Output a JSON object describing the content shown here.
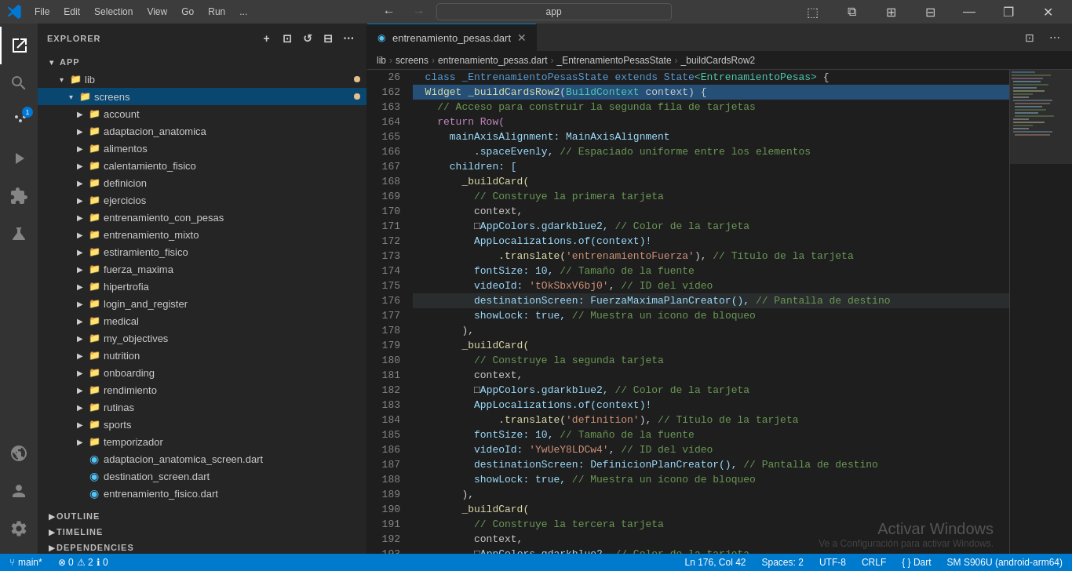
{
  "titlebar": {
    "logo": "⬡",
    "menu_items": [
      "File",
      "Edit",
      "Selection",
      "View",
      "Go",
      "Run",
      "..."
    ],
    "nav_back": "←",
    "nav_forward": "→",
    "search_placeholder": "app",
    "search_value": "app",
    "btn_panel": "▣",
    "btn_split": "⧉",
    "btn_layout": "⊞",
    "btn_customize": "⊟",
    "btn_minimize": "—",
    "btn_maximize": "❐",
    "btn_close": "✕"
  },
  "activity_bar": {
    "icons": [
      {
        "name": "explorer",
        "symbol": "⎘",
        "active": true
      },
      {
        "name": "search",
        "symbol": "🔍",
        "active": false
      },
      {
        "name": "source-control",
        "symbol": "⑂",
        "active": false,
        "badge": "1"
      },
      {
        "name": "run",
        "symbol": "▶",
        "active": false
      },
      {
        "name": "extensions",
        "symbol": "⊞",
        "active": false
      },
      {
        "name": "test",
        "symbol": "⚗",
        "active": false
      },
      {
        "name": "remote",
        "symbol": "◉",
        "active": false
      }
    ],
    "bottom_icons": [
      {
        "name": "account",
        "symbol": "👤"
      },
      {
        "name": "settings",
        "symbol": "⚙"
      }
    ]
  },
  "sidebar": {
    "title": "EXPLORER",
    "actions": [
      "new-file",
      "new-folder",
      "refresh",
      "collapse"
    ],
    "app_section": "APP",
    "tree": {
      "lib": {
        "label": "lib",
        "dot": true,
        "expanded": true,
        "children": {
          "screens": {
            "label": "screens",
            "dot": true,
            "expanded": true,
            "selected": true,
            "children": [
              {
                "label": "account",
                "type": "folder"
              },
              {
                "label": "adaptacion_anatomica",
                "type": "folder"
              },
              {
                "label": "alimentos",
                "type": "folder"
              },
              {
                "label": "calentamiento_fisico",
                "type": "folder"
              },
              {
                "label": "definicion",
                "type": "folder"
              },
              {
                "label": "ejercicios",
                "type": "folder"
              },
              {
                "label": "entrenamiento_con_pesas",
                "type": "folder"
              },
              {
                "label": "entrenamiento_mixto",
                "type": "folder"
              },
              {
                "label": "estiramiento_fisico",
                "type": "folder"
              },
              {
                "label": "fuerza_maxima",
                "type": "folder"
              },
              {
                "label": "hipertrofia",
                "type": "folder"
              },
              {
                "label": "login_and_register",
                "type": "folder"
              },
              {
                "label": "medical",
                "type": "folder"
              },
              {
                "label": "my_objectives",
                "type": "folder"
              },
              {
                "label": "nutrition",
                "type": "folder"
              },
              {
                "label": "onboarding",
                "type": "folder"
              },
              {
                "label": "rendimiento",
                "type": "folder"
              },
              {
                "label": "rutinas",
                "type": "folder"
              },
              {
                "label": "sports",
                "type": "folder"
              },
              {
                "label": "temporizador",
                "type": "folder"
              },
              {
                "label": "adaptacion_anatomica_screen.dart",
                "type": "dart"
              },
              {
                "label": "destination_screen.dart",
                "type": "dart"
              },
              {
                "label": "entrenamiento_fisico.dart",
                "type": "dart"
              }
            ]
          }
        }
      }
    },
    "outline_label": "OUTLINE",
    "timeline_label": "TIMELINE",
    "dependencies_label": "DEPENDENCIES"
  },
  "tabs": [
    {
      "label": "entrenamiento_pesas.dart",
      "active": true,
      "modified": false
    }
  ],
  "breadcrumb": {
    "parts": [
      "lib",
      ">",
      "screens",
      ">",
      "entrenamiento_pesas.dart",
      ">",
      "_EntrenamientoPesasState",
      ">",
      "_buildCardsRow2"
    ]
  },
  "editor": {
    "lines": [
      {
        "num": 26,
        "content": [
          {
            "t": "  class _EntrenamientoPesasState extends State",
            "c": "kw"
          },
          {
            "t": "<EntrenamientoPesas>",
            "c": "cl"
          },
          {
            "t": " {",
            "c": "punc"
          }
        ]
      },
      {
        "num": 162,
        "content": [
          {
            "t": "  Widget _buildCardsRow2",
            "c": "fn"
          },
          {
            "t": "(",
            "c": "punc"
          },
          {
            "t": "BuildContext",
            "c": "cl"
          },
          {
            "t": " context) {",
            "c": "punc"
          }
        ],
        "highlighted": true
      },
      {
        "num": 163,
        "content": [
          {
            "t": "    // Acceso para construir la segunda fila de tarjetas",
            "c": "cmt"
          }
        ]
      },
      {
        "num": 164,
        "content": [
          {
            "t": "    return Row(",
            "c": "kw2"
          }
        ]
      },
      {
        "num": 165,
        "content": [
          {
            "t": "      mainAxisAlignment: MainAxisAlignment",
            "c": "prop"
          }
        ]
      },
      {
        "num": 166,
        "content": [
          {
            "t": "          .spaceEvenly, ",
            "c": "prop"
          },
          {
            "t": "// Espaciado uniforme entre los elementos",
            "c": "cmt"
          }
        ]
      },
      {
        "num": 167,
        "content": [
          {
            "t": "      children: [",
            "c": "prop"
          }
        ]
      },
      {
        "num": 168,
        "content": [
          {
            "t": "        _buildCard(",
            "c": "fn"
          }
        ]
      },
      {
        "num": 169,
        "content": [
          {
            "t": "          // Construye la primera tarjeta",
            "c": "cmt"
          }
        ]
      },
      {
        "num": 170,
        "content": [
          {
            "t": "          context,",
            "c": "punc"
          }
        ]
      },
      {
        "num": 171,
        "content": [
          {
            "t": "          ",
            "c": ""
          },
          {
            "t": "□",
            "c": "punc"
          },
          {
            "t": "AppColors.gdarkblue2, ",
            "c": "prop"
          },
          {
            "t": "// Color de la tarjeta",
            "c": "cmt"
          }
        ]
      },
      {
        "num": 172,
        "content": [
          {
            "t": "          AppLocalizations.of(context)!",
            "c": "prop"
          }
        ]
      },
      {
        "num": 173,
        "content": [
          {
            "t": "              .translate(",
            "c": "fn"
          },
          {
            "t": "'entrenamientoFuerza'",
            "c": "str"
          },
          {
            "t": "), ",
            "c": "punc"
          },
          {
            "t": "// Título de la tarjeta",
            "c": "cmt"
          }
        ]
      },
      {
        "num": 174,
        "content": [
          {
            "t": "          fontSize: 10, ",
            "c": "prop"
          },
          {
            "t": "// Tamaño de la fuente",
            "c": "cmt"
          }
        ]
      },
      {
        "num": 175,
        "content": [
          {
            "t": "          videoId: ",
            "c": "prop"
          },
          {
            "t": "'tOkSbxV6bj0'",
            "c": "str"
          },
          {
            "t": ", ",
            "c": "punc"
          },
          {
            "t": "// ID del vídeo",
            "c": "cmt"
          }
        ]
      },
      {
        "num": 176,
        "content": [
          {
            "t": "          destinationScreen: FuerzaMaximaPlanCreator(), ",
            "c": "prop"
          },
          {
            "t": "// Pantalla de destino",
            "c": "cmt"
          }
        ],
        "current": true
      },
      {
        "num": 177,
        "content": [
          {
            "t": "          showLock: true, ",
            "c": "prop"
          },
          {
            "t": "// Muestra un ícono de bloqueo",
            "c": "cmt"
          }
        ]
      },
      {
        "num": 178,
        "content": [
          {
            "t": "        ),",
            "c": "punc"
          }
        ]
      },
      {
        "num": 179,
        "content": [
          {
            "t": "        _buildCard(",
            "c": "fn"
          }
        ]
      },
      {
        "num": 180,
        "content": [
          {
            "t": "          // Construye la segunda tarjeta",
            "c": "cmt"
          }
        ]
      },
      {
        "num": 181,
        "content": [
          {
            "t": "          context,",
            "c": "punc"
          }
        ]
      },
      {
        "num": 182,
        "content": [
          {
            "t": "          ",
            "c": ""
          },
          {
            "t": "□",
            "c": "punc"
          },
          {
            "t": "AppColors.gdarkblue2, ",
            "c": "prop"
          },
          {
            "t": "// Color de la tarjeta",
            "c": "cmt"
          }
        ]
      },
      {
        "num": 183,
        "content": [
          {
            "t": "          AppLocalizations.of(context)!",
            "c": "prop"
          }
        ]
      },
      {
        "num": 184,
        "content": [
          {
            "t": "              .translate(",
            "c": "fn"
          },
          {
            "t": "'definition'",
            "c": "str"
          },
          {
            "t": "), ",
            "c": "punc"
          },
          {
            "t": "// Título de la tarjeta",
            "c": "cmt"
          }
        ]
      },
      {
        "num": 185,
        "content": [
          {
            "t": "          fontSize: 10, ",
            "c": "prop"
          },
          {
            "t": "// Tamaño de la fuente",
            "c": "cmt"
          }
        ]
      },
      {
        "num": 186,
        "content": [
          {
            "t": "          videoId: ",
            "c": "prop"
          },
          {
            "t": "'YwUeY8LDCw4'",
            "c": "str"
          },
          {
            "t": ", ",
            "c": "punc"
          },
          {
            "t": "// ID del vídeo",
            "c": "cmt"
          }
        ]
      },
      {
        "num": 187,
        "content": [
          {
            "t": "          destinationScreen: DefinicionPlanCreator(), ",
            "c": "prop"
          },
          {
            "t": "// Pantalla de destino",
            "c": "cmt"
          }
        ]
      },
      {
        "num": 188,
        "content": [
          {
            "t": "          showLock: true, ",
            "c": "prop"
          },
          {
            "t": "// Muestra un ícono de bloqueo",
            "c": "cmt"
          }
        ]
      },
      {
        "num": 189,
        "content": [
          {
            "t": "        ),",
            "c": "punc"
          }
        ]
      },
      {
        "num": 190,
        "content": [
          {
            "t": "        _buildCard(",
            "c": "fn"
          }
        ]
      },
      {
        "num": 191,
        "content": [
          {
            "t": "          // Construye la tercera tarjeta",
            "c": "cmt"
          }
        ]
      },
      {
        "num": 192,
        "content": [
          {
            "t": "          context,",
            "c": "punc"
          }
        ]
      },
      {
        "num": 193,
        "content": [
          {
            "t": "          ",
            "c": ""
          },
          {
            "t": "□",
            "c": "punc"
          },
          {
            "t": "AppColors.gdarkblue2, ",
            "c": "prop"
          },
          {
            "t": "// Color de la tarjeta",
            "c": "cmt"
          }
        ]
      }
    ]
  },
  "statusbar": {
    "branch": "main*",
    "errors": "⊗ 0",
    "warnings": "⚠ 2",
    "info": "ℹ 0",
    "position": "Ln 176, Col 42",
    "spaces": "Spaces: 2",
    "encoding": "UTF-8",
    "line_ending": "CRLF",
    "language": "{ } Dart",
    "device": "SM S906U (android-arm64)",
    "watermark_line1": "Activar Windows",
    "watermark_line2": "Ve a Configuración para activar Windows."
  }
}
